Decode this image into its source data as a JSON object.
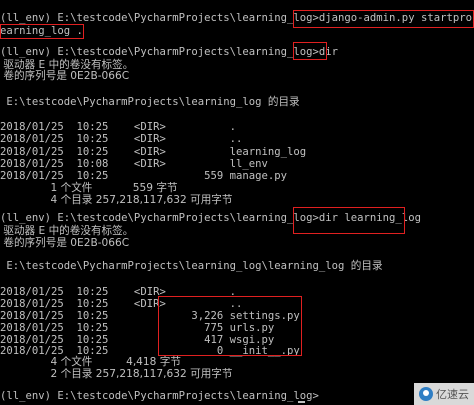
{
  "console": {
    "lines": [
      "(ll_env) E:\\testcode\\PycharmProjects\\learning_log>django-admin.py startproject l",
      "earning_log .",
      "",
      "(ll_env) E:\\testcode\\PycharmProjects\\learning_log>dir",
      " 驱动器 E 中的卷没有标签。",
      " 卷的序列号是 0E2B-066C",
      "",
      " E:\\testcode\\PycharmProjects\\learning_log 的目录",
      "",
      "2018/01/25  10:25    <DIR>          .",
      "2018/01/25  10:25    <DIR>          ..",
      "2018/01/25  10:25    <DIR>          learning_log",
      "2018/01/25  10:08    <DIR>          ll_env",
      "2018/01/25  10:25               559 manage.py",
      "               1 个文件            559 字节",
      "               4 个目录 257,218,117,632 可用字节",
      "",
      "(ll_env) E:\\testcode\\PycharmProjects\\learning_log>dir learning_log",
      " 驱动器 E 中的卷没有标签。",
      " 卷的序列号是 0E2B-066C",
      "",
      " E:\\testcode\\PycharmProjects\\learning_log\\learning_log 的目录",
      "",
      "2018/01/25  10:25    <DIR>          .",
      "2018/01/25  10:25    <DIR>          ..",
      "2018/01/25  10:25             3,226 settings.py",
      "2018/01/25  10:25               775 urls.py",
      "2018/01/25  10:25               417 wsgi.py",
      "2018/01/25  10:25                 0 __init__.py",
      "               4 个文件          4,418 字节",
      "               2 个目录 257,218,117,632 可用字节",
      "",
      "(ll_env) E:\\testcode\\PycharmProjects\\learning_log>"
    ]
  },
  "watermark": {
    "text": "亿速云"
  },
  "colors": {
    "background": "#000000",
    "text": "#c0c0c0",
    "highlight": "#e02020"
  }
}
